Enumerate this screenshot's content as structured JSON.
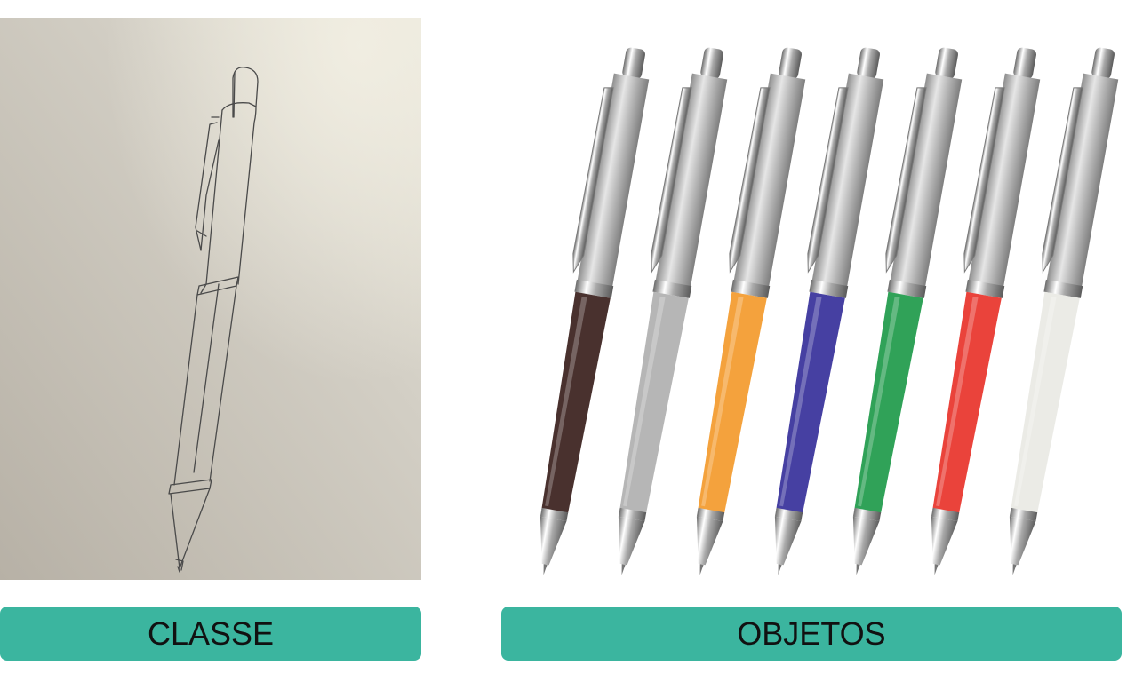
{
  "colors": {
    "label_bg": "#3bb59f",
    "label_text": "#111111",
    "sketch_paper_light": "#e6e2d6",
    "sketch_paper_dark": "#b9b3a8",
    "pencil_line": "#444444",
    "pen_silver": "#b8b8b8",
    "pen_grip_colors": [
      "#3a1f1c",
      "#b0b0b0",
      "#f39a2c",
      "#36309a",
      "#1e9a4a",
      "#e8332a",
      "#e9e9e4"
    ]
  },
  "labels": {
    "left": "CLASSE",
    "right": "OBJETOS"
  },
  "icons": {
    "left_image": "pencil-sketch-of-pen",
    "right_image": "row-of-ballpoint-pens"
  }
}
